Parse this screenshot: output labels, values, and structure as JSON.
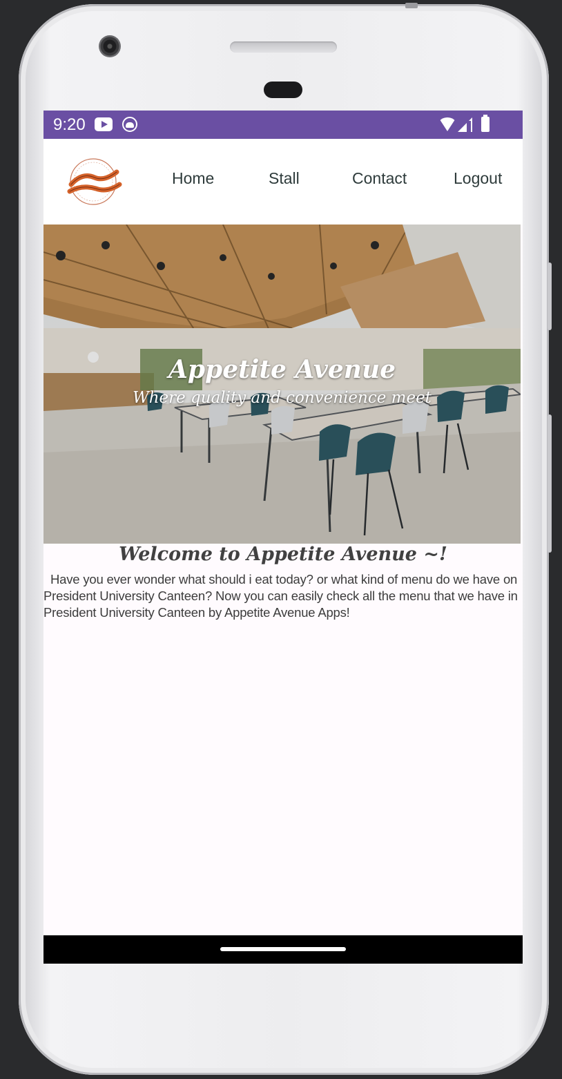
{
  "status_bar": {
    "time": "9:20",
    "background": "#6a4fa3"
  },
  "nav": {
    "logo_alt": "Appetite Avenue",
    "items": [
      {
        "label": "Home"
      },
      {
        "label": "Stall"
      },
      {
        "label": "Contact"
      },
      {
        "label": "Logout"
      }
    ]
  },
  "hero": {
    "title": "Appetite Avenue",
    "subtitle": "Where quality and convenience meet"
  },
  "welcome": {
    "title": "Welcome to Appetite Avenue ~!",
    "body": "Have you ever wonder what should i eat today? or what kind of menu do we have on President University Canteen? Now you can easily check all the menu that we have in President University Canteen by Appetite Avenue Apps!"
  },
  "colors": {
    "accent": "#6a4fa3",
    "logo_orange": "#d4622a",
    "nav_text": "#2e3b3b"
  }
}
